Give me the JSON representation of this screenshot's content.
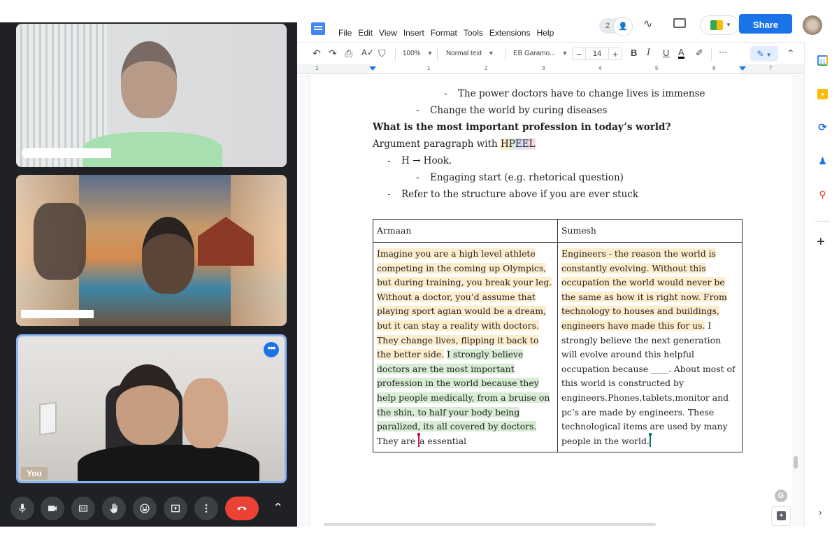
{
  "meet": {
    "tiles": [
      {
        "name_label": "",
        "name_redacted": true
      },
      {
        "name_label": "",
        "name_redacted": true
      },
      {
        "name_label": "You",
        "more_options_icon": "more-horiz-icon"
      }
    ],
    "controls": [
      {
        "name": "microphone",
        "icon": "mic-icon"
      },
      {
        "name": "camera",
        "icon": "videocam-icon"
      },
      {
        "name": "captions",
        "icon": "closed-caption-icon",
        "glyph": "CC"
      },
      {
        "name": "raise-hand",
        "icon": "hand-icon"
      },
      {
        "name": "reactions",
        "icon": "emoji-icon"
      },
      {
        "name": "present",
        "icon": "present-screen-icon"
      },
      {
        "name": "more-options",
        "icon": "more-vert-icon"
      },
      {
        "name": "leave-call",
        "icon": "call-end-icon"
      }
    ],
    "expand_icon": "chevron-up-icon",
    "colors": {
      "panel_bg": "#202124",
      "button_bg": "#3c4043",
      "end_call": "#ea4335",
      "active_border": "#8ab4f8"
    }
  },
  "docs": {
    "menu": [
      "File",
      "Edit",
      "View",
      "Insert",
      "Format",
      "Tools",
      "Extensions",
      "Help"
    ],
    "header": {
      "collaborator_count": "2",
      "share_label": "Share"
    },
    "toolbar": {
      "zoom": "100%",
      "style": "Normal text",
      "font": "EB Garamo...",
      "font_size": "14",
      "bold": "B",
      "italic": "I",
      "underline": "U",
      "text_color": "A",
      "more": "⋯"
    },
    "ruler": [
      "1",
      "1",
      "2",
      "3",
      "4",
      "5",
      "6",
      "7"
    ],
    "content": {
      "bullet_l2_power": "The power doctors have to change lives is immense",
      "bullet_l1_change": "Change the world by curing diseases",
      "question": "What is the most important profession in today’s world?",
      "argument_prefix": "Argument paragraph with ",
      "hpeel": [
        "H",
        "P",
        "E",
        "E",
        "L"
      ],
      "hook": "H → Hook.",
      "engaging": "Engaging start (e.g. rhetorical question)",
      "refer": "Refer to the structure above if you are ever stuck",
      "dash": "-"
    },
    "table": {
      "headers": [
        "Armaan",
        "Sumesh"
      ],
      "armaan": {
        "yellow": "Imagine you are a high level athlete competing in the coming up Olympics, but during training, you break your leg. Without a doctor, you’d assume that playing sport agian would be a dream, but it can stay a reality with doctors. They change lives, flipping it back to the better side.",
        "green": "I strongly believe doctors are the most important profession in the world because they help people medically, from a bruise on the shin, to half your body being paralized, its all covered by doctors.",
        "plain_before_cursor": "They are ",
        "plain_after_cursor": "a essential"
      },
      "sumesh": {
        "yellow": "Engineers - the reason the world is constantly evolving. Without this occupation the world would never be the same as how it is right now. From technology to houses and buildings, engineers have made this for us.",
        "plain": "I strongly believe the next generation will evolve around this helpful occupation because ____. About most of this world is constructed by engineers.Phones,tablets,monitor and pc’s are made by engineers. These technological items are used by many people in the world."
      }
    },
    "side_panel": [
      "Calendar",
      "Keep",
      "Tasks",
      "Contacts",
      "Maps"
    ],
    "side_calendar_day": "31",
    "colors": {
      "share": "#1a73e8",
      "highlight_yellow": "#fdedcc",
      "highlight_green": "#d9ecd6",
      "cursor_pink": "#c2185b",
      "cursor_teal": "#00796b"
    }
  }
}
